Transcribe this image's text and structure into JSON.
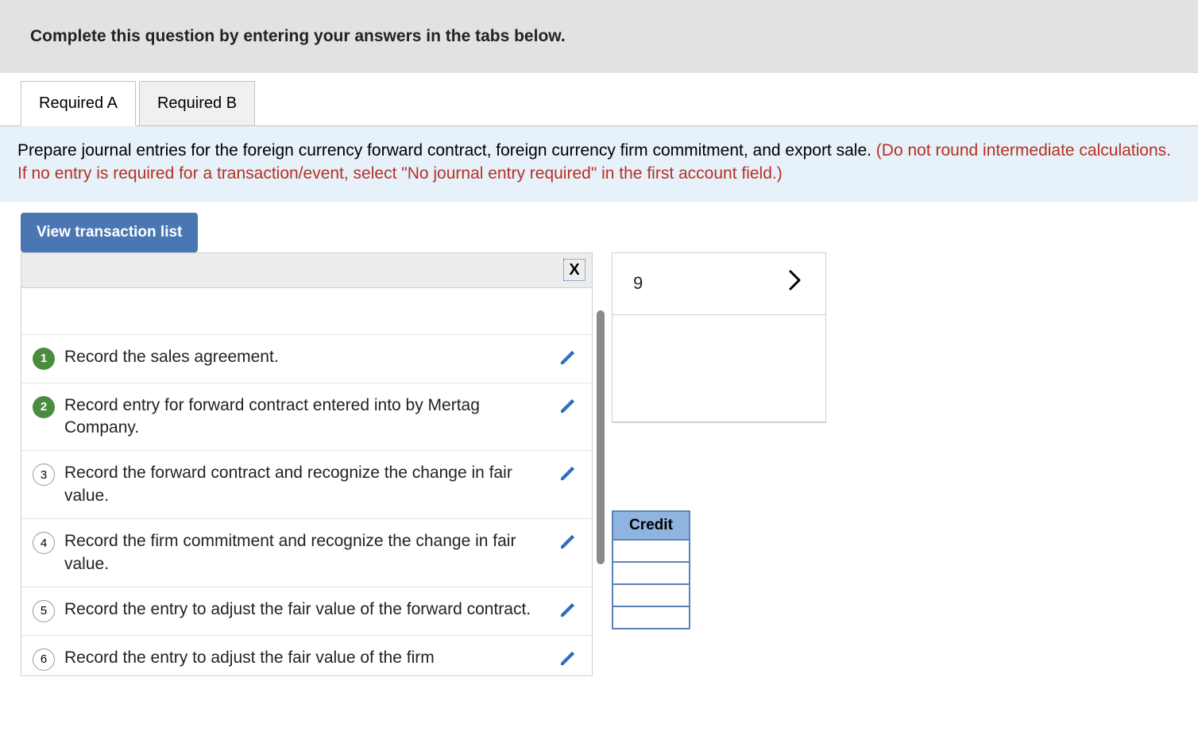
{
  "instruction": "Complete this question by entering your answers in the tabs below.",
  "tabs": [
    {
      "label": "Required A",
      "active": true
    },
    {
      "label": "Required B",
      "active": false
    }
  ],
  "prompt": {
    "black": "Prepare journal entries for the foreign currency forward contract, foreign currency firm commitment, and export sale. ",
    "red": "(Do not round intermediate calculations. If no entry is required for a transaction/event, select \"No journal entry required\" in the first account field.)"
  },
  "view_button": "View transaction list",
  "nav": {
    "page": "9"
  },
  "credit_header": "Credit",
  "transactions": [
    {
      "num": "1",
      "text": "Record the sales agreement.",
      "done": true
    },
    {
      "num": "2",
      "text": "Record entry for forward contract entered into by Mertag Company.",
      "done": true
    },
    {
      "num": "3",
      "text": "Record the forward contract and recognize the change in fair value.",
      "done": false
    },
    {
      "num": "4",
      "text": "Record the firm commitment and recognize the change in fair value.",
      "done": false
    },
    {
      "num": "5",
      "text": "Record the entry to adjust the fair value of the forward contract.",
      "done": false
    },
    {
      "num": "6",
      "text": "Record the entry to adjust the fair value of the firm",
      "done": false
    }
  ]
}
